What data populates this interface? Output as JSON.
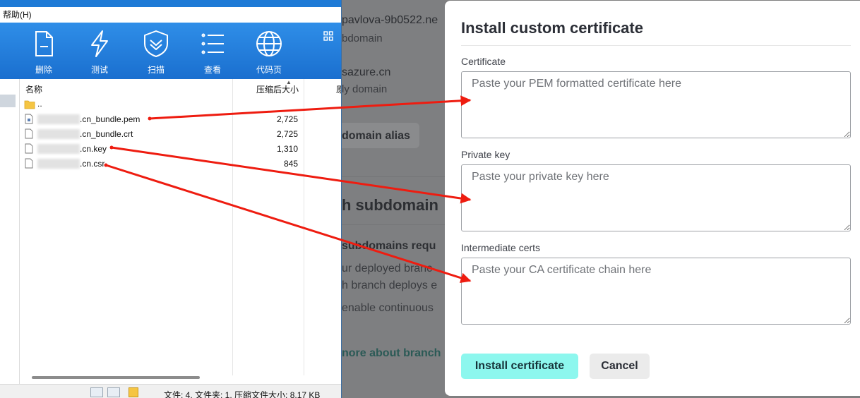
{
  "file_manager": {
    "menu_item": "帮助(H)",
    "toolbar": [
      {
        "label": "删除",
        "icon": "delete-file-icon"
      },
      {
        "label": "测试",
        "icon": "lightning-icon"
      },
      {
        "label": "扫描",
        "icon": "shield-scan-icon"
      },
      {
        "label": "查看",
        "icon": "list-view-icon"
      },
      {
        "label": "代码页",
        "icon": "globe-icon"
      }
    ],
    "columns": {
      "name": "名称",
      "size": "压缩后大小",
      "type": "原"
    },
    "parent_dir": "..",
    "files": [
      {
        "name": ".cn_bundle.pem",
        "size": "2,725"
      },
      {
        "name": ".cn_bundle.crt",
        "size": "2,725"
      },
      {
        "name": ".cn.key",
        "size": "1,310"
      },
      {
        "name": ".cn.csr",
        "size": "845"
      }
    ],
    "status": "文件: 4, 文件夹: 1, 压缩文件大小: 8.17 KB"
  },
  "background_page": {
    "lines": [
      {
        "text": "pavlova-9b0522.ne",
        "style": "main"
      },
      {
        "text": "bdomain",
        "style": "sub"
      },
      {
        "text": "sazure.cn",
        "style": "main"
      },
      {
        "text": "ly domain",
        "style": "sub"
      },
      {
        "text": "domain alias",
        "style": "bold"
      },
      {
        "text": "h subdomain",
        "style": "heading"
      },
      {
        "text": "subdomains requ",
        "style": "bold"
      },
      {
        "text": "ur deployed branc",
        "style": "body"
      },
      {
        "text": "h branch deploys e",
        "style": "body"
      },
      {
        "text": "enable continuous",
        "style": "body"
      },
      {
        "text": "nore about branch",
        "style": "link"
      }
    ]
  },
  "modal": {
    "title": "Install custom certificate",
    "fields": [
      {
        "label": "Certificate",
        "placeholder": "Paste your PEM formatted certificate here"
      },
      {
        "label": "Private key",
        "placeholder": "Paste your private key here"
      },
      {
        "label": "Intermediate certs",
        "placeholder": "Paste your CA certificate chain here"
      }
    ],
    "install_label": "Install certificate",
    "cancel_label": "Cancel"
  },
  "colors": {
    "toolbar_blue": "#1e7ad6",
    "arrow_red": "#ee1c10",
    "install_button": "#8df7ee",
    "cancel_button": "#ebebeb"
  }
}
